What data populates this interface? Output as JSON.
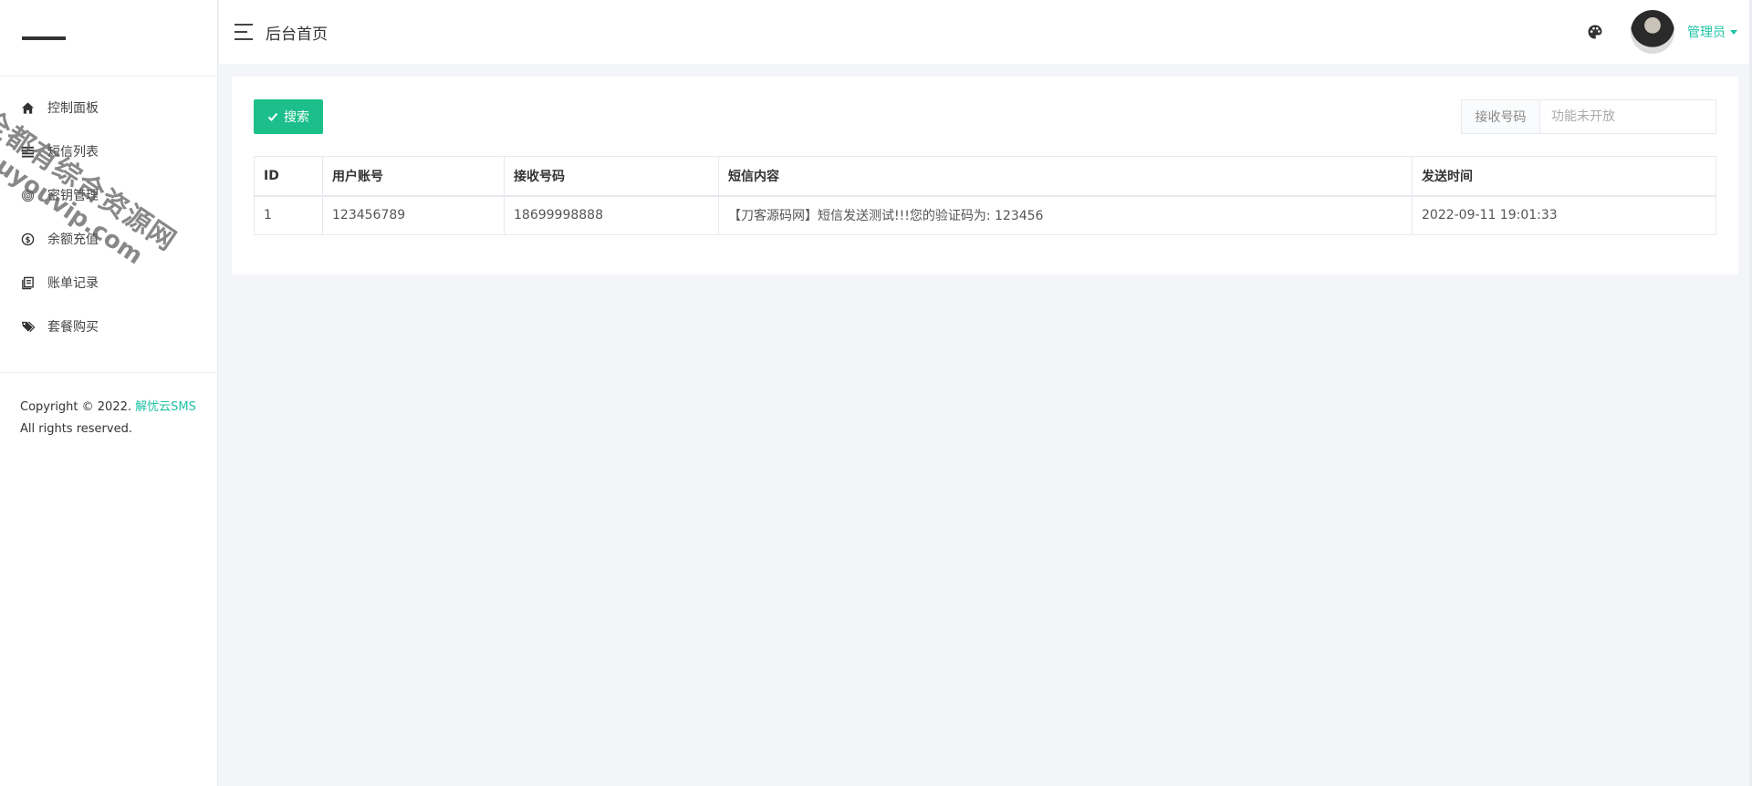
{
  "header": {
    "title": "后台首页",
    "user_name": "管理员"
  },
  "sidebar": {
    "items": [
      {
        "label": "控制面板",
        "icon": "home-icon"
      },
      {
        "label": "短信列表",
        "icon": "list-icon"
      },
      {
        "label": "密钥管理",
        "icon": "fingerprint-icon"
      },
      {
        "label": "余额充值",
        "icon": "dollar-circle-icon"
      },
      {
        "label": "账单记录",
        "icon": "book-icon"
      },
      {
        "label": "套餐购买",
        "icon": "tags-icon"
      }
    ],
    "copyright_prefix": "Copyright © 2022.",
    "brand": "解忧云SMS",
    "rights": "All rights reserved."
  },
  "toolbar": {
    "search_label": "搜索",
    "filter_label": "接收号码",
    "filter_placeholder": "功能未开放"
  },
  "table": {
    "headers": [
      "ID",
      "用户账号",
      "接收号码",
      "短信内容",
      "发送时间"
    ],
    "rows": [
      [
        "1",
        "123456789",
        "18699998888",
        "【刀客源码网】短信发送测试!!!您的验证码为: 123456",
        "2022-09-11 19:01:33"
      ]
    ]
  },
  "watermark": {
    "line1": "全都有综合资源网",
    "line2": "douyouvip.com"
  },
  "colors": {
    "accent": "#1ec3a6",
    "search_button": "#1cbf8a",
    "background": "#f3f5f9"
  }
}
